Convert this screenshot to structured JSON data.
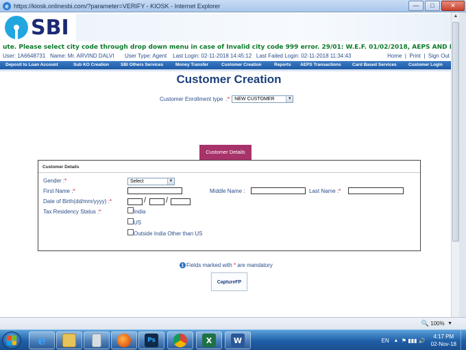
{
  "browser": {
    "title": "https://kiosk.onlinesbi.com/?parameter=VERIFY - KIOSK - Internet Explorer",
    "zoom": "100%"
  },
  "logo": {
    "text": "SBI"
  },
  "marquee": "ute. Please select city code through drop down menu in case of Invalid city code 999 error. 29/01: W.E.F. 01/02/2018, AEPS AND EKYC SERVICES SHALL BE AV",
  "userbar": {
    "user": "User:  1A6648731",
    "name": "Name:  Mr.  ARVIND DALVI",
    "type": "User Type:  Agent",
    "last_login": "Last Login: 02-11-2018 14:45:12",
    "last_failed": "Last Failed Login: 02-11-2018 11:34:43",
    "home": "Home",
    "print": "Print",
    "signout": "Sign Out",
    "sep": "|"
  },
  "nav": [
    "Deposit to Loan Account",
    "Sub KO Creation",
    "SBI Others Services",
    "Money Transfer",
    "Customer Creation",
    "Reports",
    "AEPS Transactions",
    "Card Based Services",
    "Customer Login"
  ],
  "page": {
    "title": "Customer Creation",
    "enroll_label": "Customer Enrollment type",
    "enroll_colon": ":",
    "enroll_value": "NEW CUSTOMER",
    "tab": "Customer Details"
  },
  "form": {
    "box_header": "Customer Details",
    "gender_label": "Gender  :",
    "gender_value": "Select",
    "first_name_label": "First Name  :",
    "middle_name_label": "Middle Name  :",
    "last_name_label": "Last Name  :",
    "dob_label": "Date of Birth(dd/mm/yyyy)  :",
    "tax_label": "Tax Residency Status  :",
    "tax_options": [
      "India",
      "US",
      "Outside India Other than US"
    ],
    "slash": "/",
    "required_mark": "*"
  },
  "footer": {
    "mandatory_prefix": "Fields marked with",
    "mandatory_suffix": "are mandatory",
    "capture_button": "CaptureFP"
  },
  "taskbar": {
    "apps": [
      "Internet Explorer",
      "File Explorer",
      "Calculator",
      "Firefox",
      "Photoshop",
      "Chrome",
      "Excel",
      "Word"
    ],
    "lang": "EN",
    "time": "4:17 PM",
    "date": "02-Nov-18"
  }
}
